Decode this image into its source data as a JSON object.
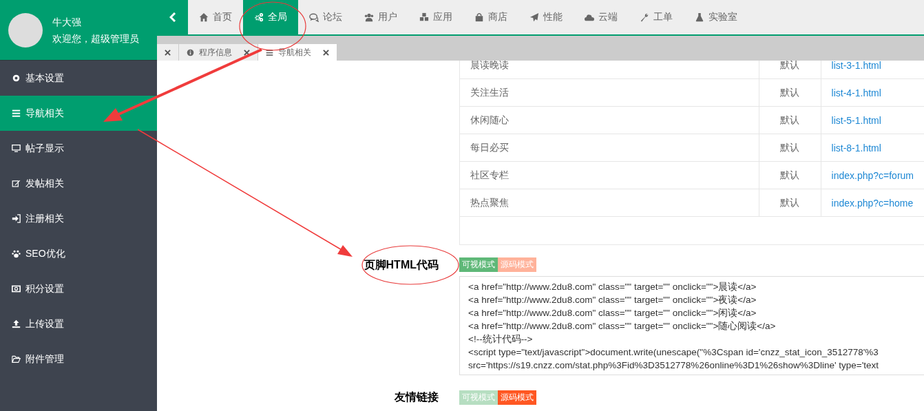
{
  "user": {
    "name": "牛大强",
    "greeting": "欢迎您，超级管理员"
  },
  "top_nav": [
    {
      "label": "首页",
      "selected": false
    },
    {
      "label": "全局",
      "selected": true
    },
    {
      "label": "论坛",
      "selected": false
    },
    {
      "label": "用户",
      "selected": false
    },
    {
      "label": "应用",
      "selected": false
    },
    {
      "label": "商店",
      "selected": false
    },
    {
      "label": "性能",
      "selected": false
    },
    {
      "label": "云端",
      "selected": false
    },
    {
      "label": "工单",
      "selected": false
    },
    {
      "label": "实验室",
      "selected": false
    }
  ],
  "sidebar": {
    "items": [
      {
        "label": "基本设置",
        "selected": false
      },
      {
        "label": "导航相关",
        "selected": true
      },
      {
        "label": "帖子显示",
        "selected": false
      },
      {
        "label": "发帖相关",
        "selected": false
      },
      {
        "label": "注册相关",
        "selected": false
      },
      {
        "label": "SEO优化",
        "selected": false
      },
      {
        "label": "积分设置",
        "selected": false
      },
      {
        "label": "上传设置",
        "selected": false
      },
      {
        "label": "附件管理",
        "selected": false
      }
    ]
  },
  "page_tabs": [
    {
      "label": "程序信息",
      "selected": false
    },
    {
      "label": "导航相关",
      "selected": true
    }
  ],
  "table": {
    "rows": [
      {
        "name": "晨读晚读",
        "type": "默认",
        "url": "list-3-1.html"
      },
      {
        "name": "关注生活",
        "type": "默认",
        "url": "list-4-1.html"
      },
      {
        "name": "休闲随心",
        "type": "默认",
        "url": "list-5-1.html"
      },
      {
        "name": "每日必买",
        "type": "默认",
        "url": "list-8-1.html"
      },
      {
        "name": "社区专栏",
        "type": "默认",
        "url": "index.php?c=forum"
      },
      {
        "name": "热点聚焦",
        "type": "默认",
        "url": "index.php?c=home"
      }
    ]
  },
  "fields": [
    {
      "label": "页脚HTML代码",
      "modes": [
        {
          "label": "可视模式",
          "kind": "visual",
          "selected": true
        },
        {
          "label": "源码模式",
          "kind": "source",
          "selected": false
        }
      ],
      "code_lines": [
        "<a href=\"http://www.2du8.com\" class=\"\" target=\"\" onclick=\"\">晨读</a>",
        "<a href=\"http://www.2du8.com\" class=\"\" target=\"\" onclick=\"\">夜读</a>",
        "<a href=\"http://www.2du8.com\" class=\"\" target=\"\" onclick=\"\">闲读</a>",
        "<a href=\"http://www.2du8.com\" class=\"\" target=\"\" onclick=\"\">随心阅读</a>",
        "<!--统计代码-->",
        "<script type=\"text/javascript\">document.write(unescape(\"%3Cspan id='cnzz_stat_icon_3512778'%3",
        "src='https://s19.cnzz.com/stat.php%3Fid%3D3512778%26online%3D1%26show%3Dline' type='text"
      ]
    },
    {
      "label": "友情链接",
      "modes": [
        {
          "label": "可视模式",
          "kind": "visual",
          "selected": false
        },
        {
          "label": "源码模式",
          "kind": "source",
          "selected": true
        }
      ]
    }
  ]
}
